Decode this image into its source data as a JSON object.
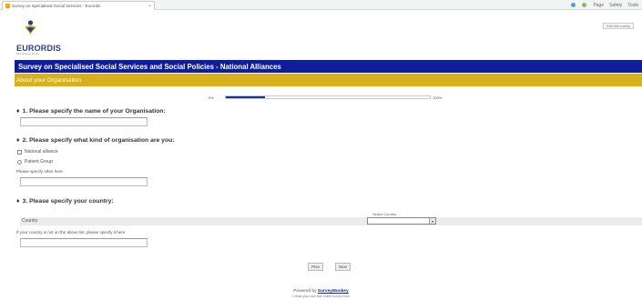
{
  "browser": {
    "tab_title": "Survey on Specialised Social Services - Eurordis",
    "tab_close": "×",
    "tools": [
      {
        "label": "",
        "color": "#4aa3df"
      },
      {
        "label": "",
        "color": "#7fbf5b"
      },
      {
        "label": "Page",
        "color": "#9aa3ad"
      },
      {
        "label": "Safety",
        "color": "#9aa3ad"
      },
      {
        "label": "Tools",
        "color": "#9aa3ad"
      }
    ],
    "favorites_button": "Edit this survey"
  },
  "logo": {
    "text": "EURORDIS",
    "sub": "Rare Diseases Europe"
  },
  "page": {
    "title": "Survey on Specialised Social Services and Social Policies - National Alliances",
    "section": "About your Organisation"
  },
  "progress": {
    "label": "0%",
    "percent": 0.19,
    "end": "100%"
  },
  "q1": {
    "bullet": "♦",
    "text": "1. Please specify the name of your Organisation:"
  },
  "q2": {
    "bullet": "♦",
    "text": "2. Please specify what kind of organisation are you:",
    "options": [
      "National alliance",
      "Patient Group"
    ],
    "other_label": "Please specify other here"
  },
  "q3": {
    "bullet": "♦",
    "text": "3. Please specify your country:",
    "select_caption": "Select Country",
    "row_label": "Country",
    "select_arrow": "▾",
    "note": "If your country is not on the above list, please specify it here"
  },
  "buttons": {
    "prev": "Prev",
    "next": "Next"
  },
  "footer": {
    "powered_by": "Powered by",
    "brand": "SurveyMonkey",
    "line2": "Create your own free online survey now!"
  }
}
